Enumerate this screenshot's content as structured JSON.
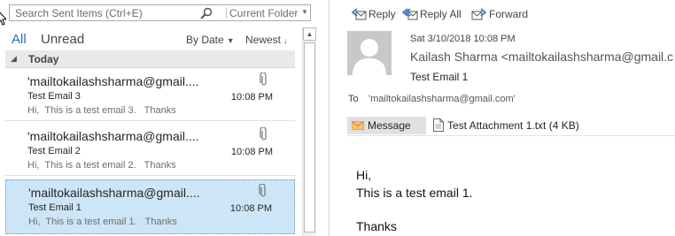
{
  "search": {
    "placeholder": "Search Sent Items (Ctrl+E)",
    "scope": "Current Folder"
  },
  "filters": {
    "all": "All",
    "unread": "Unread",
    "sort_by": "By Date",
    "sort_order": "Newest"
  },
  "group": {
    "label": "Today"
  },
  "messages": [
    {
      "from": "'mailtokailashsharma@gmail....",
      "subject": "Test Email 3",
      "preview": "Hi,  This is a test email 3.   Thanks",
      "time": "10:08 PM",
      "selected": false
    },
    {
      "from": "'mailtokailashsharma@gmail....",
      "subject": "Test Email 2",
      "preview": "Hi,  This is a test email 2.   Thanks",
      "time": "10:08 PM",
      "selected": false
    },
    {
      "from": "'mailtokailashsharma@gmail....",
      "subject": "Test Email 1",
      "preview": "Hi,  This is a test email 1.   Thanks",
      "time": "10:08 PM",
      "selected": true
    }
  ],
  "actions": {
    "reply": "Reply",
    "reply_all": "Reply All",
    "forward": "Forward"
  },
  "reading": {
    "date": "Sat 3/10/2018 10:08 PM",
    "sender": "Kailash Sharma <mailtokailashsharma@gmail.c",
    "subject": "Test Email 1",
    "to_label": "To",
    "to_value": "'mailtokailashsharma@gmail.com'",
    "message_tab": "Message",
    "attachment": "Test Attachment 1.txt (4 KB)",
    "body": {
      "line1": "Hi,",
      "line2": "This is a test email 1.",
      "line3": "Thanks"
    }
  },
  "colors": {
    "accent": "#2b6cc4",
    "selected_row": "#cde6f7",
    "envelope": "#e8a445"
  },
  "icons": {
    "search": "search-icon",
    "attachment": "paperclip-icon",
    "reply": "reply-icon",
    "reply_all": "reply-all-icon",
    "forward": "forward-icon",
    "message": "envelope-icon",
    "file": "file-icon",
    "avatar": "person-placeholder-icon"
  }
}
